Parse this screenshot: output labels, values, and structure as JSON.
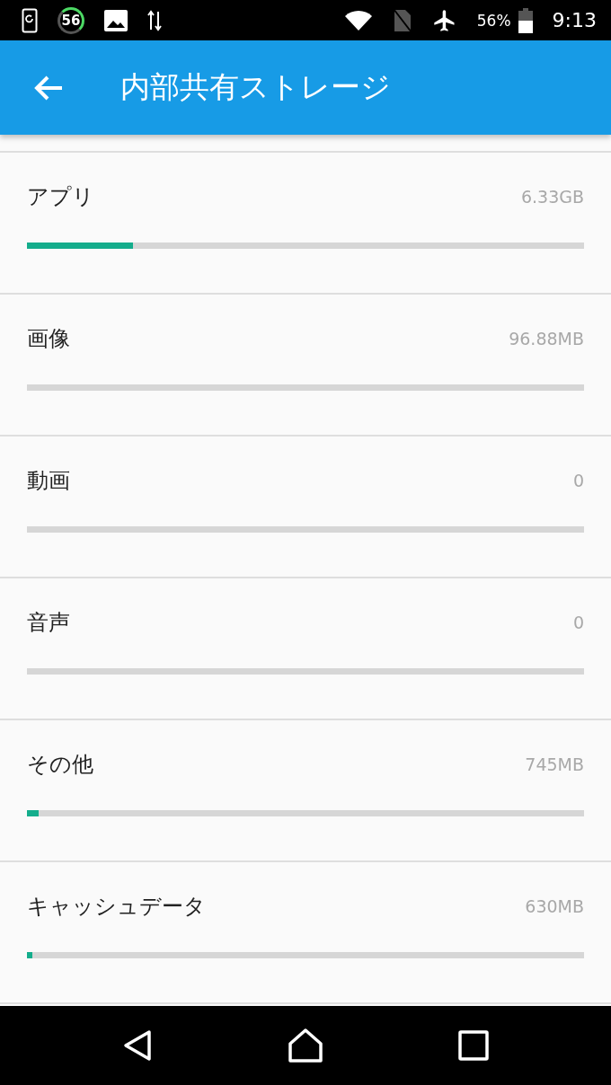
{
  "status_bar": {
    "notification_count": "56",
    "battery": "56%",
    "time": "9:13"
  },
  "app_bar": {
    "title": "内部共有ストレージ"
  },
  "storage_items": [
    {
      "label": "アプリ",
      "size": "6.33GB",
      "level": 0.19
    },
    {
      "label": "画像",
      "size": "96.88MB"
    },
    {
      "label": "動画",
      "size": "0"
    },
    {
      "label": "音声",
      "size": "0"
    },
    {
      "label": "その他",
      "size": "745MB",
      "level": 0.021
    },
    {
      "label": "キャッシュデータ",
      "size": "630MB",
      "level": 0.01
    }
  ]
}
